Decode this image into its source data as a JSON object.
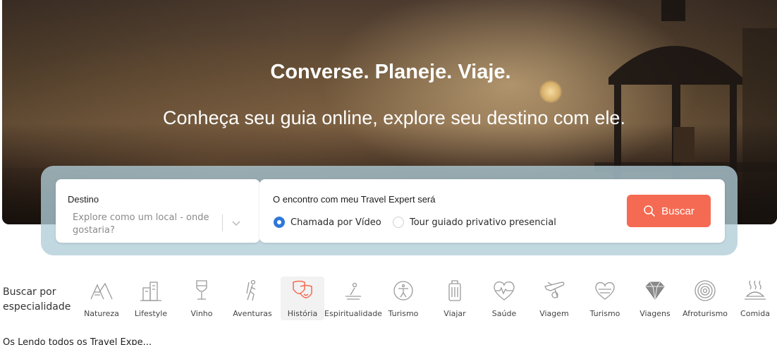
{
  "hero": {
    "title": "Converse. Planeje. Viaje.",
    "subtitle": "Conheça seu guia online, explore seu destino com ele."
  },
  "search": {
    "destino_label": "Destino",
    "destino_placeholder": "Explore como um local - onde gostaria?",
    "encontro_label": "O encontro com meu Travel Expert será",
    "options": [
      {
        "label": "Chamada por Vídeo",
        "selected": true
      },
      {
        "label": "Tour guiado privativo presencial",
        "selected": false
      }
    ],
    "button_label": "Buscar",
    "button_color": "#f56a52"
  },
  "specialties": {
    "label": "Buscar por especialidade",
    "items": [
      {
        "label": "Natureza",
        "icon": "mountains-icon"
      },
      {
        "label": "Lifestyle",
        "icon": "buildings-icon"
      },
      {
        "label": "Vinho",
        "icon": "wine-glass-icon"
      },
      {
        "label": "Aventuras",
        "icon": "hiker-icon"
      },
      {
        "label": "História",
        "icon": "theater-masks-icon",
        "active": true
      },
      {
        "label": "Espiritualidade",
        "icon": "meditation-icon"
      },
      {
        "label": "Turismo",
        "icon": "accessibility-icon"
      },
      {
        "label": "Viajar",
        "icon": "luggage-icon"
      },
      {
        "label": "Saúde",
        "icon": "heartbeat-icon"
      },
      {
        "label": "Viagem",
        "icon": "airplane-icon"
      },
      {
        "label": "Turismo",
        "icon": "heart-icon"
      },
      {
        "label": "Viagens",
        "icon": "diamond-icon"
      },
      {
        "label": "Afroturismo",
        "icon": "concentric-circles-icon"
      },
      {
        "label": "Comida",
        "icon": "hot-dish-icon"
      }
    ]
  },
  "bottom_text": "Os Lendo todos os Travel Expe..."
}
